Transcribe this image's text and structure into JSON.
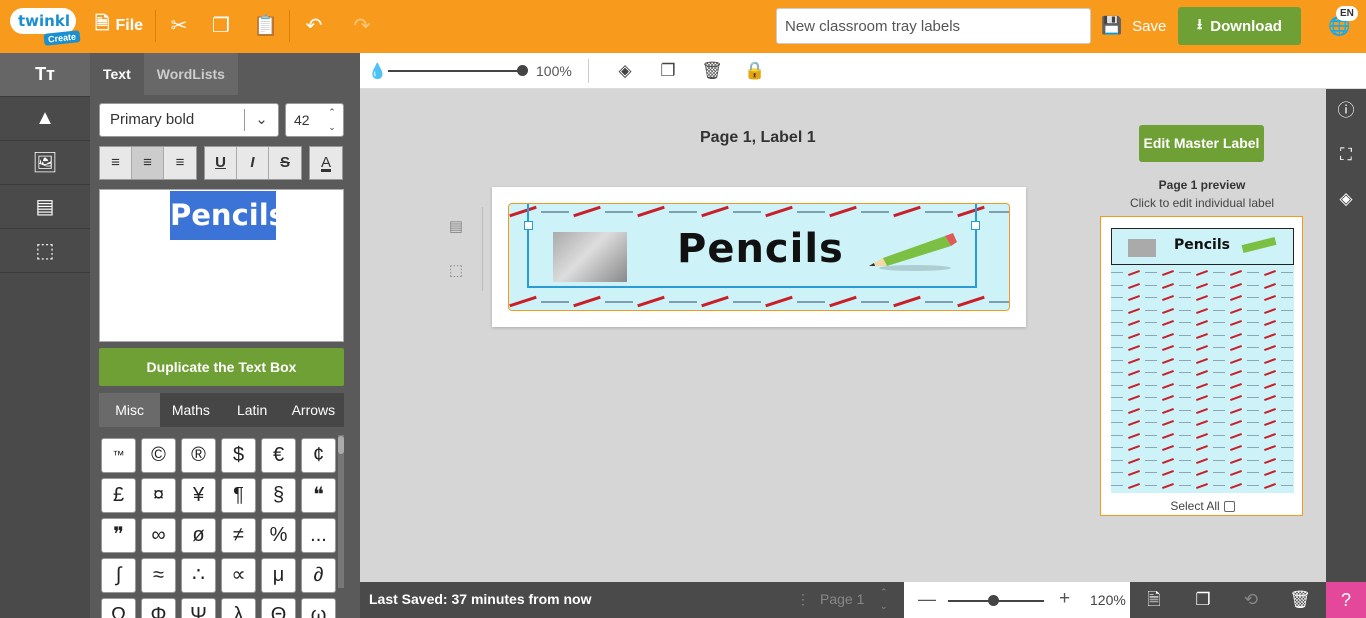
{
  "topbar": {
    "logo_brand": "twinkl",
    "logo_sub": "Create",
    "file_label": "File",
    "document_title": "New classroom tray labels",
    "save_label": "Save",
    "download_label": "Download",
    "language": "EN",
    "colors": {
      "bar": "#f89a1c",
      "download": "#6fa035"
    }
  },
  "panel": {
    "tabs": [
      {
        "label": "Text"
      },
      {
        "label": "WordLists"
      }
    ],
    "font_name": "Primary bold",
    "font_size": "42",
    "text_value": "Pencils",
    "duplicate_label": "Duplicate the Text Box",
    "symbol_tabs": [
      {
        "label": "Misc"
      },
      {
        "label": "Maths"
      },
      {
        "label": "Latin"
      },
      {
        "label": "Arrows"
      }
    ],
    "symbols": [
      "™",
      "©",
      "®",
      "$",
      "€",
      "¢",
      "£",
      "¤",
      "¥",
      "¶",
      "§",
      "❝",
      "❞",
      "∞",
      "ø",
      "≠",
      "%",
      "...",
      "∫",
      "≈",
      "∴",
      "∝",
      "μ",
      "∂",
      "Ω",
      "Φ",
      "Ψ",
      "λ",
      "Θ",
      "ω"
    ]
  },
  "toolbar": {
    "opacity_value": "100%"
  },
  "canvas": {
    "page_label": "Page 1, Label 1",
    "label_text": "Pencils",
    "edit_master_label": "Edit Master Label",
    "preview_title": "Page 1 preview",
    "preview_subtitle": "Click to edit individual label",
    "preview_label_text": "Pencils",
    "select_all_label": "Select All"
  },
  "bottombar": {
    "last_saved": "Last Saved: 37 minutes from now",
    "page_selector": "Page 1",
    "zoom_value": "120%",
    "help_symbol": "?"
  }
}
